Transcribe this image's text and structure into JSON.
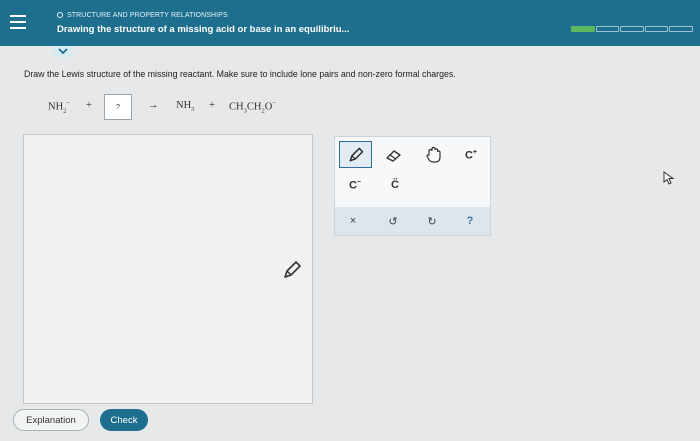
{
  "header": {
    "section": "STRUCTURE AND PROPERTY RELATIONSHIPS",
    "title": "Drawing the structure of a missing acid or base in an equilibriu...",
    "progress_total": 5,
    "progress_filled": 1,
    "progress_color": "#5cb85c",
    "accent": "#1e6f8e"
  },
  "instruction": "Draw the Lewis structure of the missing reactant. Make sure to include lone pairs and non-zero formal charges.",
  "equation": {
    "reactant1": {
      "base": "NH",
      "sub": "2",
      "sup": "−"
    },
    "plus1": "+",
    "missing": "?",
    "arrow": "→",
    "product1": {
      "base": "NH",
      "sub": "3"
    },
    "plus2": "+",
    "product2": {
      "a": "CH",
      "a_sub": "3",
      "b": "CH",
      "b_sub": "2",
      "c": "O",
      "c_sup": "−"
    }
  },
  "toolbar": {
    "tools": [
      "pencil-icon",
      "eraser-icon",
      "hand-icon",
      "positive-charge-icon",
      "negative-charge-icon",
      "lone-pair-icon"
    ],
    "neg_charge_base": "C",
    "neg_charge_sup": "−",
    "pos_charge_base": "C",
    "pos_charge_sup": "+",
    "lone_pair": "C̈",
    "clear": "×",
    "undo": "↺",
    "redo": "↻",
    "help": "?"
  },
  "buttons": {
    "explanation": "Explanation",
    "check": "Check"
  }
}
